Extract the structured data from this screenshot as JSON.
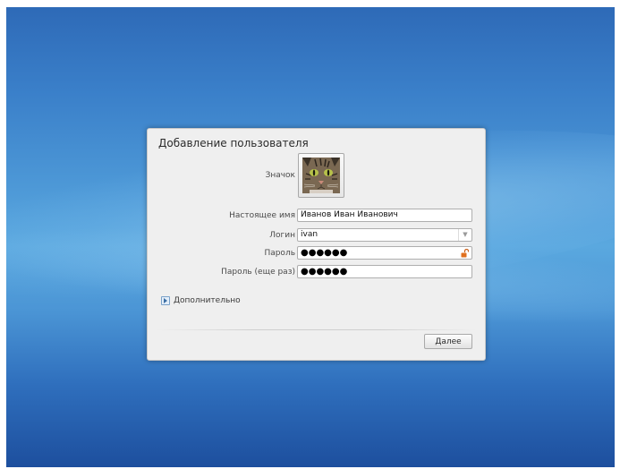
{
  "dialog": {
    "title": "Добавление пользователя",
    "icon_label": "Значок",
    "realname_label": "Настоящее имя",
    "realname_value": "Иванов Иван Иванович",
    "login_label": "Логин",
    "login_value": "ivan",
    "password_label": "Пароль",
    "password_value": "●●●●●●",
    "password_repeat_label": "Пароль (еще раз)",
    "password_repeat_value": "●●●●●●",
    "advanced_label": "Дополнительно",
    "next_label": "Далее"
  },
  "icons": {
    "avatar": "cat-photo",
    "combo_arrow": "chevron-down-icon",
    "lock": "unlocked-padlock-icon",
    "expander": "expander-arrow-icon"
  },
  "colors": {
    "desktop_blue": "#3a7fc9",
    "dialog_bg": "#efefef",
    "lock_orange": "#e0701e"
  }
}
